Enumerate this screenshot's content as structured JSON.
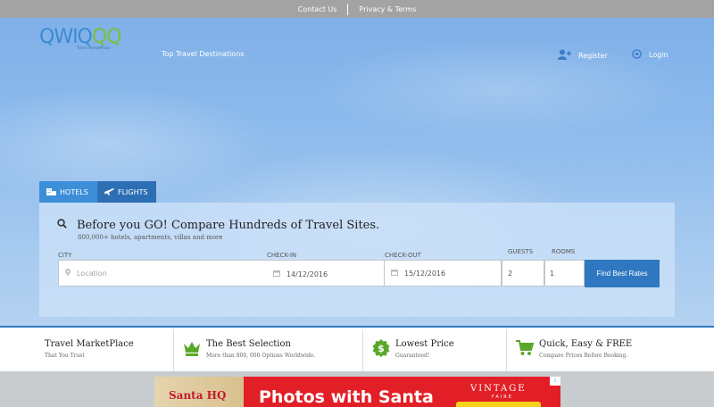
{
  "topbar": {
    "contact_label": "Contact Us",
    "privacy_label": "Privacy & Terms"
  },
  "header": {
    "logo_text": "QWIQQQ",
    "logo_tagline": "Travel MarketPlace",
    "nav_destinations": "Top Travel Destinations",
    "register_label": "Register",
    "login_label": "Login"
  },
  "search": {
    "tabs": [
      {
        "label": "HOTELS",
        "icon": "hotel-icon",
        "active": true
      },
      {
        "label": "FLIGHTS",
        "icon": "plane-icon",
        "active": false
      }
    ],
    "title": "Before you GO! Compare Hundreds of Travel Sites.",
    "subtitle": "800,000+ hotels, apartments, villas and more",
    "city_label": "CITY",
    "city_placeholder": "Location",
    "checkin_label": "CHECK-IN",
    "checkin_value": "14/12/2016",
    "checkout_label": "CHECK-OUT",
    "checkout_value": "15/12/2016",
    "guests_label": "GUESTS",
    "guests_value": "2",
    "rooms_label": "ROOMS",
    "rooms_value": "1",
    "submit_label": "Find Best Rates"
  },
  "features": [
    {
      "title": "Travel MarketPlace",
      "subtitle": "That You Trust",
      "icon": null
    },
    {
      "title": "The Best Selection",
      "subtitle": "More than 800, 000 Options Worldwide.",
      "icon": "crown-icon"
    },
    {
      "title": "Lowest Price",
      "subtitle": "Guaranteed!",
      "icon": "dollar-badge-icon"
    },
    {
      "title": "Quick, Easy & FREE",
      "subtitle": "Compare Prices Before Booking.",
      "icon": "cart-icon"
    }
  ],
  "ad": {
    "logo_text": "Santa HQ",
    "headline": "Photos with Santa",
    "brand": "VINTAGE",
    "brand_sub": "FAIRE",
    "choices_label": "i"
  },
  "colors": {
    "topbar": "#a3a3a3",
    "accent_blue": "#2f78c1",
    "tab_active": "#3d8ed8",
    "icon_green": "#5aa82a",
    "ad_red": "#e21f26"
  }
}
